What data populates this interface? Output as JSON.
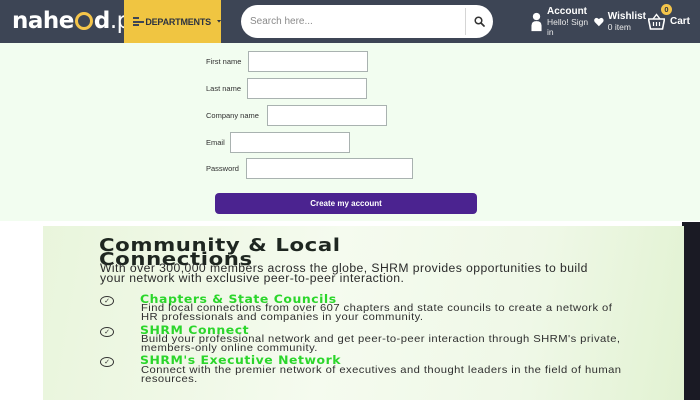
{
  "header": {
    "logo": {
      "prefix": "nahe",
      "suffix": "d",
      "tld": ".pk"
    },
    "departments_label": "DEPARTMENTS",
    "search_placeholder": "Search here...",
    "account": {
      "title": "Account",
      "subtitle": "Hello! Sign in"
    },
    "wishlist": {
      "title": "Wishlist",
      "subtitle": "0 item"
    },
    "cart": {
      "title": "Cart",
      "count": "0"
    },
    "colors": {
      "bar": "#3d4555",
      "accent": "#f0c541"
    },
    "icons": [
      "hamburger-icon",
      "chevron-down-icon",
      "search-icon",
      "user-icon",
      "heart-icon",
      "basket-icon"
    ]
  },
  "form": {
    "fields": [
      {
        "label": "First name",
        "value": ""
      },
      {
        "label": "Last name",
        "value": ""
      },
      {
        "label": "Company name",
        "value": ""
      },
      {
        "label": "Email",
        "value": ""
      },
      {
        "label": "Password",
        "value": ""
      }
    ],
    "submit_label": "Create my account",
    "submit_color": "#4b2390"
  },
  "promo": {
    "title_line1": "Community & Local",
    "title_line2": "Connections",
    "intro": "With over 300,000 members across the globe, SHRM provides opportunities to build your network with exclusive peer-to-peer interaction.",
    "items": [
      {
        "title": "Chapters & State Councils",
        "desc": "Find local connections from over 607 chapters and state councils to create a network of HR professionals and companies in your community."
      },
      {
        "title": "SHRM Connect",
        "desc": "Build your professional network and get peer-to-peer interaction through SHRM's private, members-only online community."
      },
      {
        "title": "SHRM's Executive Network",
        "desc": "Connect with the premier network of executives and thought leaders in the field of human resources."
      }
    ],
    "accent_color": "#2bd62b",
    "check_icon": "check-circle-icon"
  }
}
